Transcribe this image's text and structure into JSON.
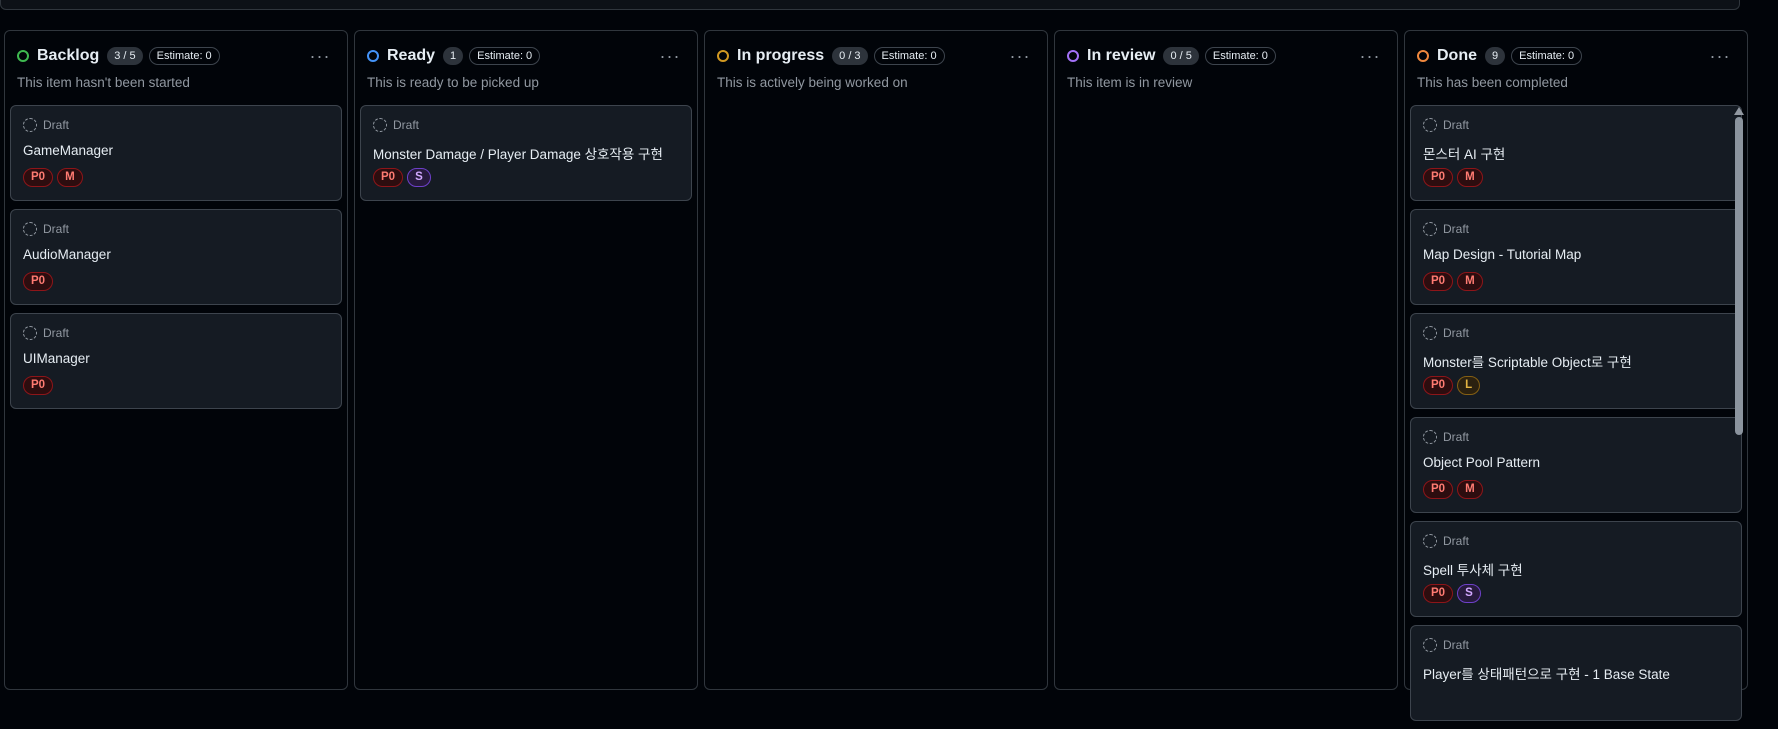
{
  "columns": [
    {
      "name": "Backlog",
      "count": "3 / 5",
      "estimate": "Estimate: 0",
      "description": "This item hasn't been started",
      "color": "#3fb950",
      "cards": [
        {
          "status": "Draft",
          "title": "GameManager",
          "labels": [
            "P0",
            "M"
          ]
        },
        {
          "status": "Draft",
          "title": "AudioManager",
          "labels": [
            "P0"
          ]
        },
        {
          "status": "Draft",
          "title": "UIManager",
          "labels": [
            "P0"
          ]
        }
      ]
    },
    {
      "name": "Ready",
      "count": "1",
      "estimate": "Estimate: 0",
      "description": "This is ready to be picked up",
      "color": "#4493f8",
      "cards": [
        {
          "status": "Draft",
          "title": "Monster Damage / Player Damage 상호작용 구현",
          "labels": [
            "P0",
            "S"
          ]
        }
      ]
    },
    {
      "name": "In progress",
      "count": "0 / 3",
      "estimate": "Estimate: 0",
      "description": "This is actively being worked on",
      "color": "#d29922",
      "cards": []
    },
    {
      "name": "In review",
      "count": "0 / 5",
      "estimate": "Estimate: 0",
      "description": "This item is in review",
      "color": "#a371f7",
      "cards": []
    },
    {
      "name": "Done",
      "count": "9",
      "estimate": "Estimate: 0",
      "description": "This has been completed",
      "color": "#f0883e",
      "cards": [
        {
          "status": "Draft",
          "title": "몬스터 AI 구현",
          "labels": [
            "P0",
            "M"
          ]
        },
        {
          "status": "Draft",
          "title": "Map Design - Tutorial Map",
          "labels": [
            "P0",
            "M"
          ]
        },
        {
          "status": "Draft",
          "title": "Monster를 Scriptable Object로 구현",
          "labels": [
            "P0",
            "L"
          ]
        },
        {
          "status": "Draft",
          "title": "Object Pool Pattern",
          "labels": [
            "P0",
            "M"
          ]
        },
        {
          "status": "Draft",
          "title": "Spell 투사체 구현",
          "labels": [
            "P0",
            "S"
          ]
        },
        {
          "status": "Draft",
          "title": "Player를 상태패턴으로 구현 - 1 Base State",
          "labels": []
        }
      ]
    }
  ],
  "more_glyph": "···"
}
